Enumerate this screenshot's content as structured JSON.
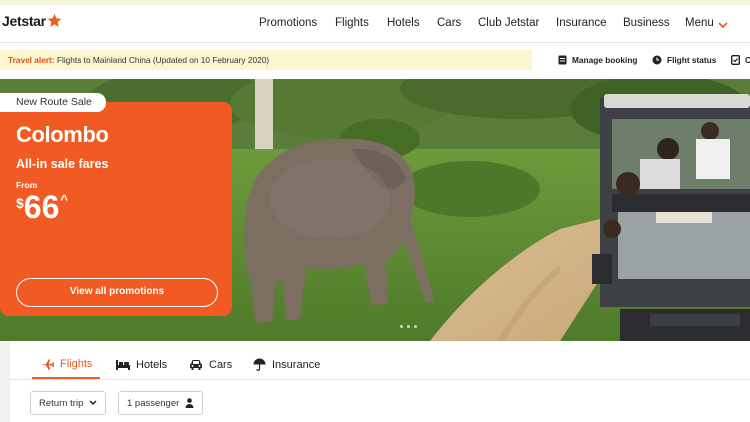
{
  "brand": {
    "name": "Jetstar",
    "accent": "#f15a22"
  },
  "nav": {
    "items": [
      {
        "label": "Promotions"
      },
      {
        "label": "Flights"
      },
      {
        "label": "Hotels"
      },
      {
        "label": "Cars"
      },
      {
        "label": "Club Jetstar"
      },
      {
        "label": "Insurance"
      },
      {
        "label": "Business"
      },
      {
        "label": "Menu"
      }
    ]
  },
  "alert": {
    "label": "Travel alert:",
    "message": "Flights to Mainland China (Updated on 10 February 2020)"
  },
  "utility": {
    "manage_booking": "Manage booking",
    "flight_status": "Flight status",
    "checkin": "C"
  },
  "promo": {
    "badge": "New Route Sale",
    "city": "Colombo",
    "subtitle": "All-in sale fares",
    "from_label": "From",
    "currency": "$",
    "price": "66",
    "caret": "^",
    "button": "View all promotions"
  },
  "search": {
    "tabs": [
      {
        "label": "Flights",
        "icon": "plane-icon",
        "active": true
      },
      {
        "label": "Hotels",
        "icon": "bed-icon",
        "active": false
      },
      {
        "label": "Cars",
        "icon": "car-icon",
        "active": false
      },
      {
        "label": "Insurance",
        "icon": "umbrella-icon",
        "active": false
      }
    ],
    "trip_type": "Return trip",
    "passengers": "1 passenger"
  }
}
